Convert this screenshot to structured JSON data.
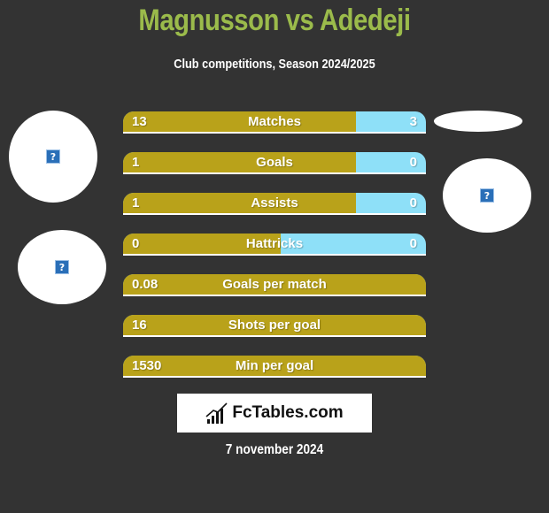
{
  "header": {
    "title": "Magnusson vs Adedeji",
    "subtitle": "Club competitions, Season 2024/2025"
  },
  "colors": {
    "background": "#333333",
    "title": "#9bbb4b",
    "left_bar": "#b9a21a",
    "right_bar": "#8ee0f8",
    "text": "#ffffff"
  },
  "players": {
    "left": {
      "name": "Magnusson",
      "image_icon": "broken-image-icon"
    },
    "right": {
      "name": "Adedeji",
      "image_icon": "broken-image-icon"
    }
  },
  "stats": [
    {
      "label": "Matches",
      "left": "13",
      "right": "3",
      "left_share": 0.77
    },
    {
      "label": "Goals",
      "left": "1",
      "right": "0",
      "left_share": 0.77
    },
    {
      "label": "Assists",
      "left": "1",
      "right": "0",
      "left_share": 0.77
    },
    {
      "label": "Hattricks",
      "left": "0",
      "right": "0",
      "left_share": 0.52
    },
    {
      "label": "Goals per match",
      "left": "0.08",
      "right": "",
      "left_share": 1.0
    },
    {
      "label": "Shots per goal",
      "left": "16",
      "right": "",
      "left_share": 1.0
    },
    {
      "label": "Min per goal",
      "left": "1530",
      "right": "",
      "left_share": 1.0
    }
  ],
  "logo": {
    "text": "FcTables.com",
    "icon": "bar-chart-icon"
  },
  "date": "7 november 2024"
}
